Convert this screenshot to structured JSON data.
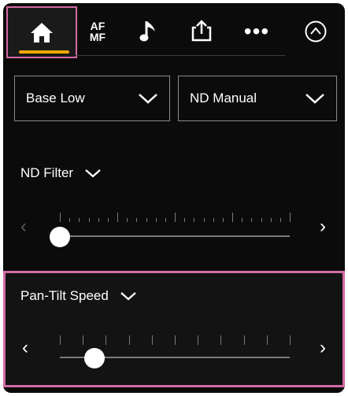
{
  "tabs": [
    {
      "name": "home",
      "icon": "home-icon"
    },
    {
      "name": "af-mf",
      "label_top": "AF",
      "label_bottom": "MF"
    },
    {
      "name": "audio",
      "icon": "music-note-icon"
    },
    {
      "name": "share",
      "icon": "share-icon"
    },
    {
      "name": "more",
      "label": "•••"
    },
    {
      "name": "collapse",
      "icon": "chevron-up-circle-icon"
    }
  ],
  "dropdowns": {
    "base": {
      "value": "Base Low"
    },
    "nd": {
      "value": "ND Manual"
    }
  },
  "nd_filter": {
    "label": "ND Filter",
    "level": 0.0
  },
  "pan_tilt": {
    "label": "Pan-Tilt Speed",
    "level": 0.15
  },
  "colors": {
    "highlight": "#d46aa6",
    "accent": "#f2a600",
    "background": "#0b0b0b"
  }
}
